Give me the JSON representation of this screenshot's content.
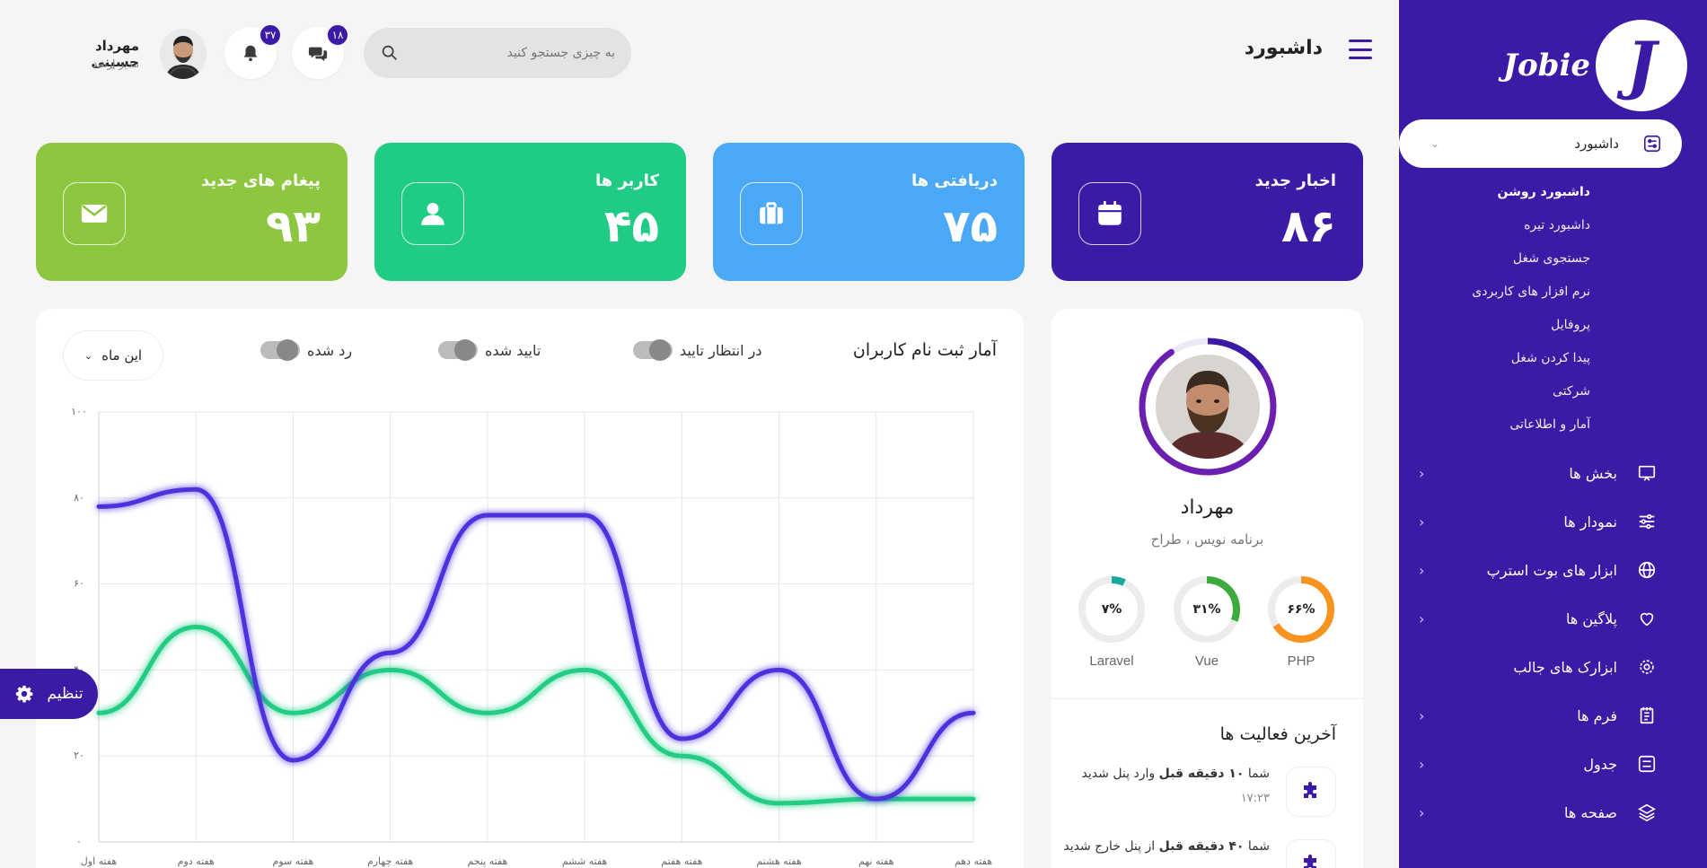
{
  "brand": {
    "name": "Jobie",
    "mark": "J"
  },
  "header": {
    "title": "داشبورد",
    "search_placeholder": "به چیزی جستجو کنید",
    "messages_badge": "۱۸",
    "notifications_badge": "۳۷",
    "user_name": "مهرداد حسینی",
    "user_role": "مدیر ارشد"
  },
  "sidebar": {
    "active": {
      "label": "داشبورد"
    },
    "submenu": [
      "داشبورد روشن",
      "داشبورد تیره",
      "جستجوی شغل",
      "نرم افزار های کاربردی",
      "پروفایل",
      "پیدا کردن شغل",
      "شرکتی",
      "آمار و اطلاعاتی"
    ],
    "items": [
      {
        "label": "بخش ها",
        "icon": "monitor-icon",
        "chevron": true
      },
      {
        "label": "نمودار ها",
        "icon": "sliders-icon",
        "chevron": true
      },
      {
        "label": "ابزار های بوت استرپ",
        "icon": "globe-icon",
        "chevron": true
      },
      {
        "label": "پلاگین ها",
        "icon": "heart-icon",
        "chevron": true
      },
      {
        "label": "ابزارک های جالب",
        "icon": "gear-icon",
        "chevron": false
      },
      {
        "label": "فرم ها",
        "icon": "clipboard-icon",
        "chevron": true
      },
      {
        "label": "جدول",
        "icon": "table-icon",
        "chevron": true
      },
      {
        "label": "صفحه ها",
        "icon": "layers-icon",
        "chevron": true
      }
    ]
  },
  "stats": [
    {
      "label": "اخبار جدید",
      "value": "۸۶",
      "color": "#3b1aa6",
      "icon": "calendar-icon"
    },
    {
      "label": "دریافتی ها",
      "value": "۷۵",
      "color": "#4aa8f6",
      "icon": "briefcase-icon"
    },
    {
      "label": "کاربر ها",
      "value": "۴۵",
      "color": "#20cc84",
      "icon": "user-icon"
    },
    {
      "label": "پیغام های جدید",
      "value": "۹۳",
      "color": "#8dc63f",
      "icon": "envelope-icon"
    }
  ],
  "profile": {
    "name": "مهرداد",
    "role": "برنامه نویس ، طراح",
    "skills": [
      {
        "name": "PHP",
        "pct": "۶۶%",
        "value": 66,
        "color": "#f7931e"
      },
      {
        "name": "Vue",
        "pct": "۳۱%",
        "value": 31,
        "color": "#3caa3c"
      },
      {
        "name": "Laravel",
        "pct": "۷%",
        "value": 7,
        "color": "#1ea7a0"
      }
    ],
    "activity_title": "آخرین فعالیت ها",
    "activities": [
      {
        "prefix": "شما ",
        "bold": "۱۰ دقیقه قبل",
        "suffix": " وارد پنل شدید",
        "time": "۱۷:۲۳"
      },
      {
        "prefix": "شما ",
        "bold": "۴۰ دقیقه قبل",
        "suffix": " از پنل خارج شدید",
        "time": ""
      }
    ]
  },
  "chart_panel": {
    "title": "آمار ثبت نام کاربران",
    "toggles": [
      "در انتظار تایید",
      "تایید شده",
      "رد شده"
    ],
    "period": "این ماه"
  },
  "chart_data": {
    "type": "line",
    "x": [
      "هفته اول",
      "هفته دوم",
      "هفته سوم",
      "هفته چهارم",
      "هفته پنجم",
      "هفته ششم",
      "هفته هفتم",
      "هفته هشتم",
      "هفته نهم",
      "هفته دهم"
    ],
    "y_ticks": [
      "۰",
      "۲۰",
      "۴۰",
      "۶۰",
      "۸۰",
      "۱۰۰"
    ],
    "ylim": [
      0,
      100
    ],
    "grid": true,
    "series": [
      {
        "color": "#4b32dd",
        "values": [
          78,
          82,
          19,
          44,
          76,
          76,
          24,
          40,
          10,
          30
        ]
      },
      {
        "color": "#20cc84",
        "values": [
          30,
          50,
          30,
          40,
          30,
          40,
          20,
          9,
          10,
          10
        ]
      }
    ]
  },
  "settings": {
    "label": "تنظیم"
  }
}
